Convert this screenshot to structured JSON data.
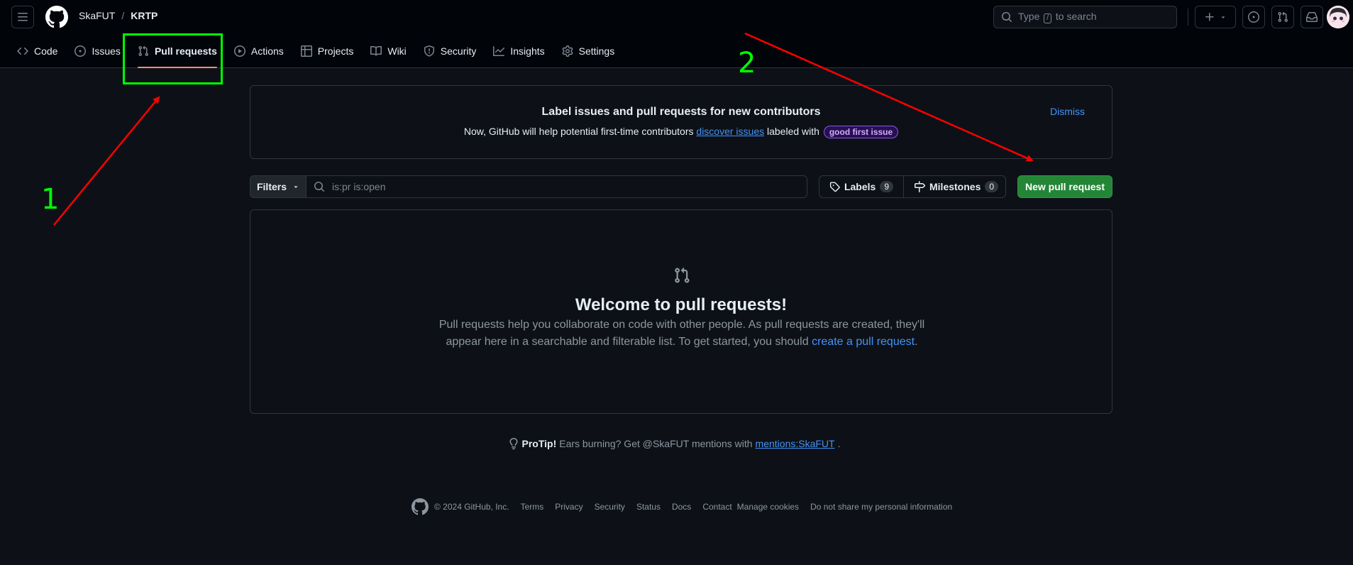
{
  "header": {
    "owner": "SkaFUT",
    "separator": "/",
    "repo": "KRTP",
    "search_prefix": "Type",
    "search_key": "/",
    "search_suffix": "to search"
  },
  "tabs": [
    {
      "label": "Code",
      "icon": "code-icon"
    },
    {
      "label": "Issues",
      "icon": "issue-opened-icon"
    },
    {
      "label": "Pull requests",
      "icon": "git-pull-request-icon",
      "active": true
    },
    {
      "label": "Actions",
      "icon": "play-icon"
    },
    {
      "label": "Projects",
      "icon": "table-icon"
    },
    {
      "label": "Wiki",
      "icon": "book-icon"
    },
    {
      "label": "Security",
      "icon": "shield-icon"
    },
    {
      "label": "Insights",
      "icon": "graph-icon"
    },
    {
      "label": "Settings",
      "icon": "gear-icon"
    }
  ],
  "banner": {
    "title": "Label issues and pull requests for new contributors",
    "text_before": "Now, GitHub will help potential first-time contributors",
    "link": "discover issues",
    "text_after": "labeled with",
    "label": "good first issue",
    "dismiss": "Dismiss"
  },
  "filter_bar": {
    "filters_label": "Filters",
    "query": "is:pr is:open",
    "labels_label": "Labels",
    "labels_count": "9",
    "milestones_label": "Milestones",
    "milestones_count": "0",
    "new_pr_label": "New pull request"
  },
  "empty_state": {
    "title": "Welcome to pull requests!",
    "text": "Pull requests help you collaborate on code with other people. As pull requests are created, they'll appear here in a searchable and filterable list. To get started, you should",
    "link": "create a pull request",
    "end": "."
  },
  "protip": {
    "label": "ProTip!",
    "text": "Ears burning? Get @SkaFUT mentions with",
    "link": "mentions:SkaFUT",
    "end": "."
  },
  "footer": {
    "copyright": "© 2024 GitHub, Inc.",
    "links": [
      "Terms",
      "Privacy",
      "Security",
      "Status",
      "Docs",
      "Contact",
      "Manage cookies",
      "Do not share my personal information"
    ]
  },
  "annotations": {
    "step1": "1",
    "step2": "2",
    "color_box": "#00ff00",
    "color_arrow": "#ff0000"
  },
  "colors": {
    "background": "#0d1117",
    "header_bg": "#010409",
    "accent_link": "#4493f8",
    "primary_button": "#238636",
    "active_tab_underline": "#fd8c73"
  }
}
